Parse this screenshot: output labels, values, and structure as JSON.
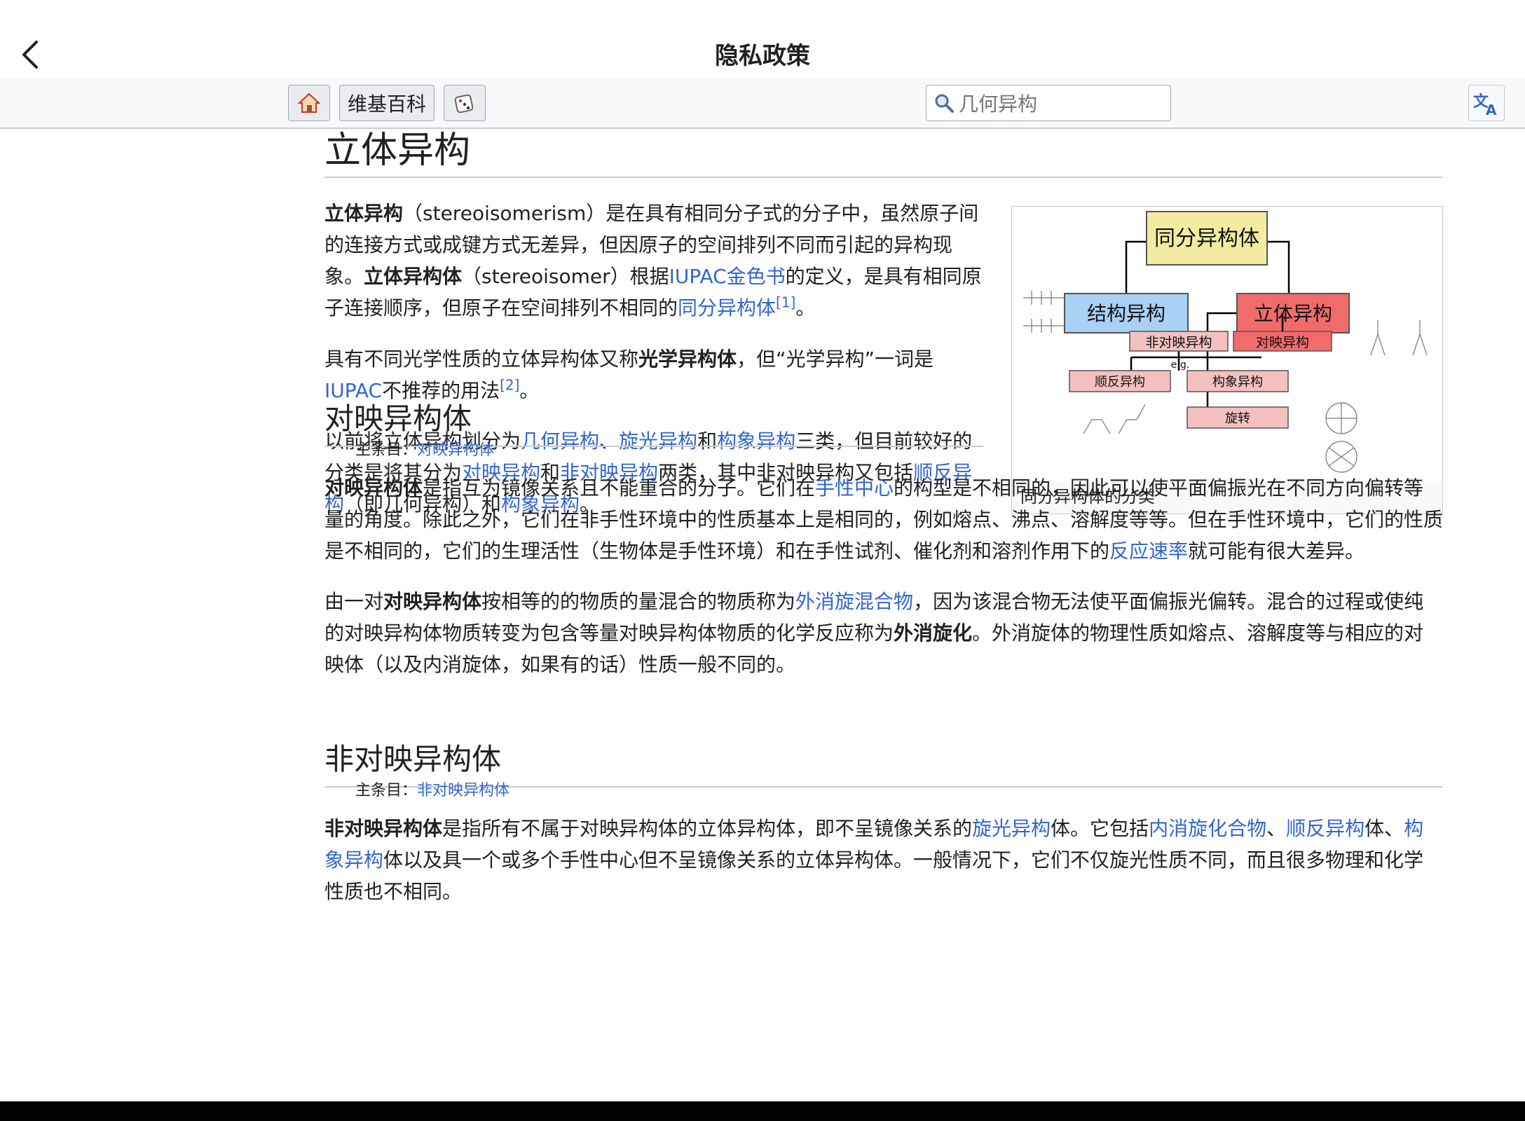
{
  "app_bar": {
    "title": "隐私政策"
  },
  "toolbar": {
    "home_icon": "home-icon",
    "wiki_label": "维基百科",
    "random_icon": "dice-icon",
    "search_placeholder": "几何异构",
    "translate_icon": "translate-icon"
  },
  "article": {
    "title": "立体异构",
    "p1": {
      "b1": "立体异构",
      "t1": "（stereoisomerism）是在具有相同分子式的分子中，虽然原子间的连接方式或成键方式无差异，但因原子的空间排列不同而引起的异构现象。",
      "b2": "立体异构体",
      "t2": "（stereoisomer）根据",
      "l1": "IUPAC金色书",
      "t3": "的定义，是具有相同原子连接顺序，但原子在空间排列不相同的",
      "l2": "同分异构体",
      "ref": "[1]",
      "t4": "。"
    },
    "p2": {
      "t1": "具有不同光学性质的立体异构体又称",
      "b1": "光学异构体",
      "t2": "，但“光学异构”一词是",
      "l1": "IUPAC",
      "t3": "不推荐的用法",
      "ref": "[2]",
      "t4": "。"
    },
    "p3": {
      "t1": "以前将立体异构划分为",
      "l1": "几何异构",
      "t2": "、",
      "l2": "旋光异构",
      "t3": "和",
      "l3": "构象异构",
      "t4": "三类，但目前较好的分类是将其分为",
      "l4": "对映异构",
      "t5": "和",
      "l5": "非对映异构",
      "t6": "两类，其中非对映异构又包括",
      "l6": "顺反异构",
      "t7": "（即几何异构）和",
      "l7": "构象异构",
      "t8": "。"
    },
    "figure": {
      "caption": "同分异构体的分类",
      "diagram": {
        "root": "同分异构体",
        "left": "结构异构",
        "right": "立体异构",
        "n_diast": "非对映异构",
        "n_enant": "对映异构",
        "eg": "e.g.",
        "n_cistrans": "顺反异构",
        "n_conf": "构象异构",
        "n_rot": "旋转"
      }
    },
    "s1": {
      "title": "对映异构体",
      "hat_prefix": "主条目：",
      "hat_link": "对映异构体",
      "p1": {
        "b1": "对映异构体",
        "t1": "是指互为镜像关系且不能重合的分子。它们在",
        "l1": "手性中心",
        "t2": "的构型是不相同的，因此可以使平面偏振光在不同方向偏转等量的角度。除此之外，它们在非手性环境中的性质基本上是相同的，例如熔点、沸点、溶解度等等。但在手性环境中，它们的性质是不相同的，它们的生理活性（生物体是手性环境）和在手性试剂、催化剂和溶剂作用下的",
        "l2": "反应速率",
        "t3": "就可能有很大差异。"
      },
      "p2": {
        "t1": "由一对",
        "b1": "对映异构体",
        "t2": "按相等的的物质的量混合的物质称为",
        "l1": "外消旋混合物",
        "t3": "，因为该混合物无法使平面偏振光偏转。混合的过程或使纯的对映异构体物质转变为包含等量对映异构体物质的化学反应称为",
        "b2": "外消旋化",
        "t4": "。外消旋体的物理性质如熔点、溶解度等与相应的对映体（以及内消旋体，如果有的话）性质一般不同的。"
      }
    },
    "s2": {
      "title": "非对映异构体",
      "hat_prefix": "主条目：",
      "hat_link": "非对映异构体",
      "p1": {
        "b1": "非对映异构体",
        "t1": "是指所有不属于对映异构体的立体异构体，即不呈镜像关系的",
        "l1": "旋光异构",
        "t2": "体。它包括",
        "l2": "内消旋化合物",
        "t3": "、",
        "l3": "顺反异构",
        "t4": "体、",
        "l4": "构象异构",
        "t5": "体以及具一个或多个手性中心但不呈镜像关系的立体异构体。一般情况下，它们不仅旋光性质不同，而且很多物理和化学性质也不相同。"
      }
    }
  }
}
